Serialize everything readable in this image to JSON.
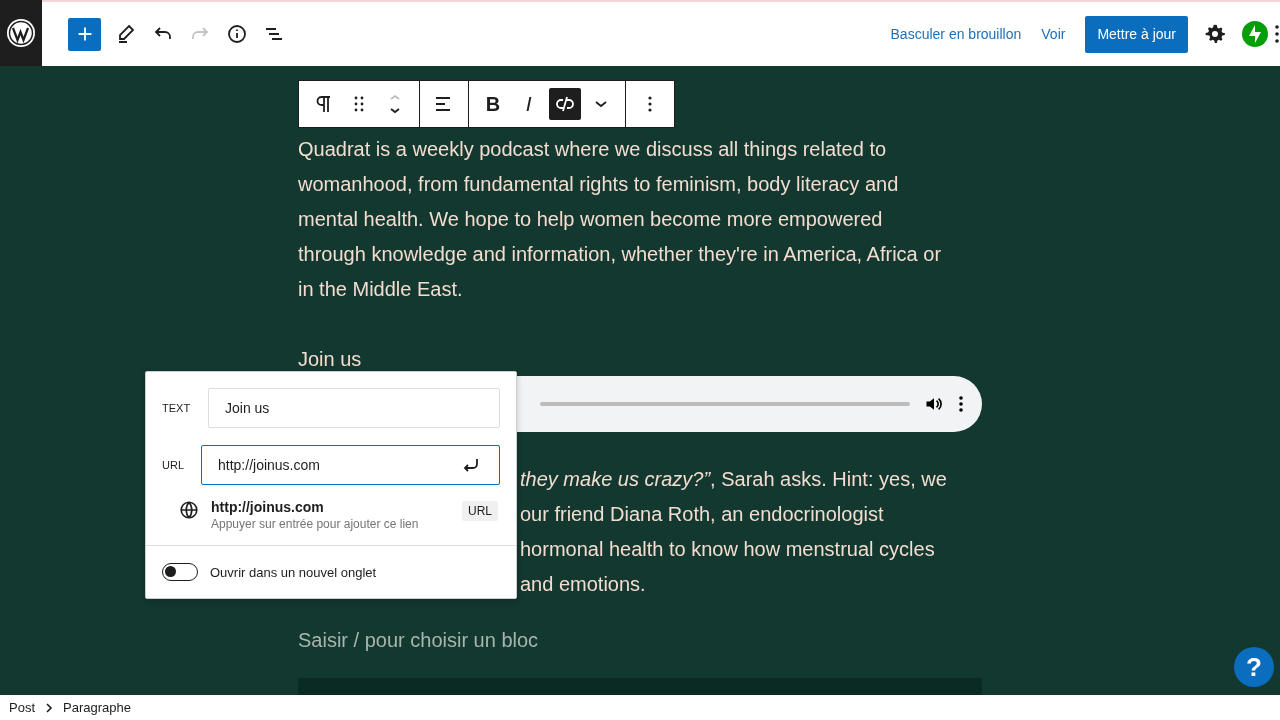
{
  "header": {
    "tools": [
      {
        "kind": "add"
      },
      {
        "kind": "edit",
        "disabled": false
      },
      {
        "kind": "undo",
        "disabled": false
      },
      {
        "kind": "redo",
        "disabled": true
      },
      {
        "kind": "info",
        "disabled": false
      },
      {
        "kind": "outline",
        "disabled": false
      }
    ],
    "draft_link": "Basculer en brouillon",
    "view_link": "Voir",
    "update_button": "Mettre à jour"
  },
  "block_toolbar": {
    "bold_label": "B",
    "italic_label": "I",
    "link_active": true
  },
  "content": {
    "paragraph": "Quadrat is a weekly podcast where we discuss all things related to womanhood, from fundamental rights to feminism, body literacy and mental health. We hope to help women become more empowered through knowledge and information, whether they're in America, Africa or in the Middle East.",
    "link_text": "Join us",
    "paragraph2_lines": [
      "*they make us crazy?”*, Sarah asks. Hint: yes, we",
      "our friend Diana Roth, an endocrinologist",
      "hormonal health to know how menstrual cycles",
      "and emotions."
    ],
    "block_placeholder": "Saisir / pour choisir un bloc"
  },
  "link_popover": {
    "text_label": "TEXT",
    "text_value": "Join us",
    "url_label": "URL",
    "url_value": "http://joinus.com",
    "suggestion": {
      "title": "http://joinus.com",
      "hint": "Appuyer sur entrée pour ajouter ce lien",
      "badge": "URL"
    },
    "new_tab": {
      "label": "Ouvrir dans un nouvel onglet",
      "on": false
    }
  },
  "breadcrumb": [
    "Post",
    "Paragraphe"
  ],
  "help_button": "?"
}
